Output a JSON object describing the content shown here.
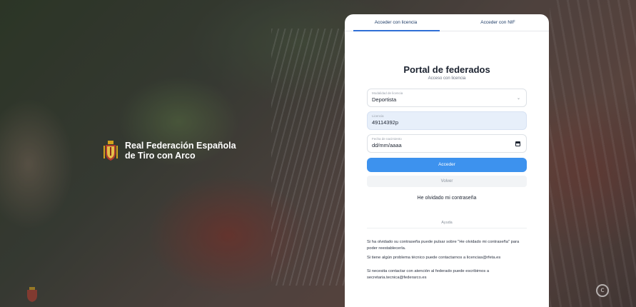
{
  "brand": {
    "line1": "Real Federación Española",
    "line2": "de Tiro con Arco"
  },
  "tabs": [
    {
      "label": "Acceder con licencia",
      "active": true
    },
    {
      "label": "Acceder con NIF",
      "active": false
    }
  ],
  "portal": {
    "title": "Portal de federados",
    "subtitle": "Acceso con licencia"
  },
  "form": {
    "modalidad": {
      "label": "Modalidad de licencia",
      "value": "Deportista"
    },
    "licencia": {
      "label": "Licencia",
      "value": "49114392p"
    },
    "fecha": {
      "label": "Fecha de nacimiento",
      "value": "dd/mm/aaaa"
    },
    "submit_label": "Acceder",
    "back_label": "Volver",
    "forgot_label": "He olvidado mi contraseña"
  },
  "help": {
    "heading": "Ayuda",
    "p1": "Si ha olvidado su contraseña puede pulsar sobre \"He olvidado mi contraseña\" para poder reestablecerla.",
    "p2": "Si tiene algún problema técnico puede contactarnos a licencias@rfeta.es",
    "p3": "Si necesita contactar con atención al federado puede escribirnos a secretaria.tecnica@federarco.es"
  },
  "colors": {
    "accent": "#3d92ee",
    "tab_indicator": "#2f6fd6",
    "filled_field": "#e7effa"
  },
  "icons": {
    "dropdown": "chevron-down-icon",
    "calendar": "calendar-icon",
    "crest": "crest-icon",
    "copyright": "copyright-icon"
  }
}
